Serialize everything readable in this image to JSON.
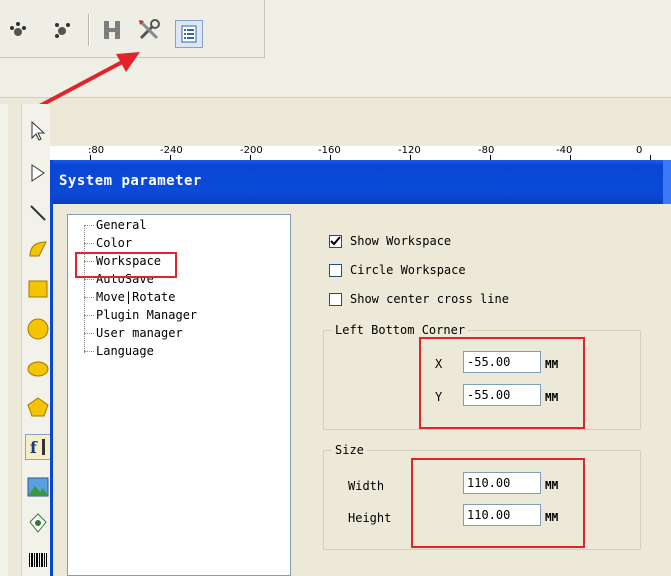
{
  "toolbar": {
    "icons": [
      "node-tool-icon",
      "node-group-icon",
      "h-icon",
      "system-parameter-icon",
      "list-icon"
    ]
  },
  "ruler": {
    "ticks": [
      ":80",
      "-240",
      "-200",
      "-160",
      "-120",
      "-80",
      "-40",
      "0"
    ]
  },
  "dialog": {
    "title": "System parameter",
    "tree": {
      "items": [
        "General",
        "Color",
        "Workspace",
        "AutoSave",
        "Move|Rotate",
        "Plugin Manager",
        "User manager",
        "Language"
      ],
      "selected": "Workspace"
    },
    "checkboxes": [
      {
        "label": "Show Workspace",
        "checked": true
      },
      {
        "label": "Circle Workspace",
        "checked": false
      },
      {
        "label": "Show center cross line",
        "checked": false
      }
    ],
    "left_bottom_corner": {
      "legend": "Left Bottom Corner",
      "x_label": "X",
      "x_value": "-55.00",
      "x_unit": "MM",
      "y_label": "Y",
      "y_value": "-55.00",
      "y_unit": "MM"
    },
    "size": {
      "legend": "Size",
      "width_label": "Width",
      "width_value": "110.00",
      "width_unit": "MM",
      "height_label": "Height",
      "height_value": "110.00",
      "height_unit": "MM"
    }
  },
  "colors": {
    "titlebar": "#0a46d4",
    "highlight": "#e0242c",
    "annotation_arrow": "#e0242c"
  }
}
